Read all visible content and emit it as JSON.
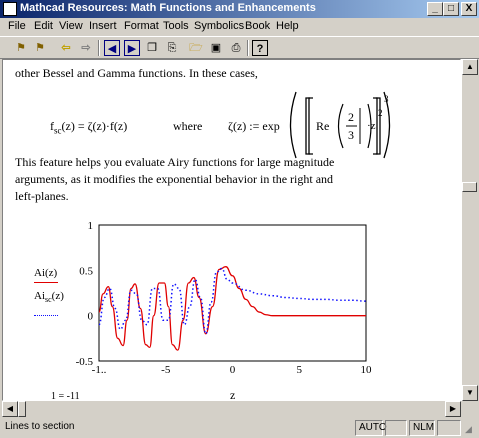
{
  "window": {
    "title": "Mathcad Resources: Math Functions and Enhancements"
  },
  "window_buttons": [
    "_",
    "□",
    "X"
  ],
  "menu": [
    "File",
    "Edit",
    "View",
    "Insert",
    "Format",
    "Tools",
    "Symbolics",
    "Book",
    "Help"
  ],
  "toolbar": {
    "icons": [
      "bookmark-icon",
      "bookmark-manage-icon",
      "back-icon",
      "forward-icon",
      "prev-section-icon",
      "next-section-icon",
      "copy-icon",
      "paste-icon",
      "open-icon",
      "save-icon",
      "print-icon",
      "help-icon"
    ]
  },
  "doc": {
    "line1": "other Bessel and Gamma functions. In these cases,",
    "eq": {
      "lhs_f": "f",
      "lhs_sub": "sc",
      "lhs_rest": "(z) = ζ(z)·f(z)",
      "where": "where",
      "rhs_start": "ζ(z) := exp",
      "re": "Re",
      "frac_num": "2",
      "frac_den": "3",
      "z": "·z",
      "exp2": "2",
      "exp3": "3"
    },
    "para": [
      "This feature helps you evaluate Airy functions for large magnitude",
      "arguments, as it modifies the exponential behavior in the right and",
      "left-planes."
    ],
    "legend": {
      "ai": "Ai(z)",
      "ai_sc_main": "Ai",
      "ai_sc_sub": "sc",
      "ai_sc_rest": "(z)"
    },
    "xlabel": "z",
    "bottom_text": "1 = -11"
  },
  "chart_data": {
    "type": "line",
    "xlim": [
      -10,
      10
    ],
    "ylim": [
      -0.5,
      1
    ],
    "x_ticks": [
      "-1..",
      "-5",
      "0",
      "5",
      "10"
    ],
    "y_ticks": [
      "1",
      "0.5",
      "0",
      "-0.5"
    ],
    "series": [
      {
        "name": "Ai(z)",
        "color": "#e00000",
        "style": "solid",
        "x": [
          -10,
          -9.7,
          -9.3,
          -9.0,
          -8.6,
          -8.2,
          -7.9,
          -7.6,
          -7.3,
          -6.9,
          -6.5,
          -6.2,
          -5.9,
          -5.5,
          -5.1,
          -4.8,
          -4.5,
          -4.1,
          -3.7,
          -3.3,
          -2.9,
          -2.5,
          -2.0,
          -1.5,
          -1.0,
          -0.5,
          0.0,
          0.5,
          1.0,
          1.5,
          2.0,
          2.5,
          3.0,
          5,
          10
        ],
        "y": [
          0.04,
          0.24,
          0.32,
          0.1,
          -0.25,
          -0.33,
          -0.05,
          0.3,
          0.35,
          0.08,
          -0.32,
          -0.35,
          0.0,
          0.36,
          0.36,
          0.1,
          -0.32,
          -0.38,
          -0.05,
          0.36,
          0.42,
          0.2,
          -0.2,
          0.1,
          0.51,
          0.54,
          0.44,
          0.3,
          0.18,
          0.1,
          0.04,
          0.01,
          0.0,
          0.0,
          0.0
        ]
      },
      {
        "name": "Ai_sc(z)",
        "color": "#1010ff",
        "style": "dotted",
        "x": [
          -10,
          -9.6,
          -9.2,
          -8.8,
          -8.4,
          -8.0,
          -7.6,
          -7.2,
          -6.8,
          -6.4,
          -6.0,
          -5.6,
          -5.2,
          -4.8,
          -4.4,
          -4.0,
          -3.6,
          -3.2,
          -2.8,
          -2.4,
          -2.0,
          -1.6,
          -1.2,
          -0.8,
          -0.4,
          0.0,
          1.0,
          2.0,
          3.0,
          4.0,
          5.0,
          6.0,
          7.0,
          8.0,
          9.0,
          10.0
        ],
        "y": [
          -0.1,
          0.2,
          0.3,
          0.08,
          -0.15,
          -0.05,
          0.28,
          0.24,
          -0.05,
          -0.1,
          0.3,
          0.3,
          -0.05,
          -0.05,
          0.35,
          0.3,
          -0.1,
          0.1,
          0.4,
          0.2,
          -0.2,
          0.15,
          0.48,
          0.52,
          0.4,
          0.36,
          0.28,
          0.24,
          0.22,
          0.2,
          0.19,
          0.18,
          0.18,
          0.17,
          0.17,
          0.16
        ]
      }
    ]
  },
  "status": {
    "text": "Lines to section",
    "auto": "AUTO",
    "nlm": "NLM"
  }
}
